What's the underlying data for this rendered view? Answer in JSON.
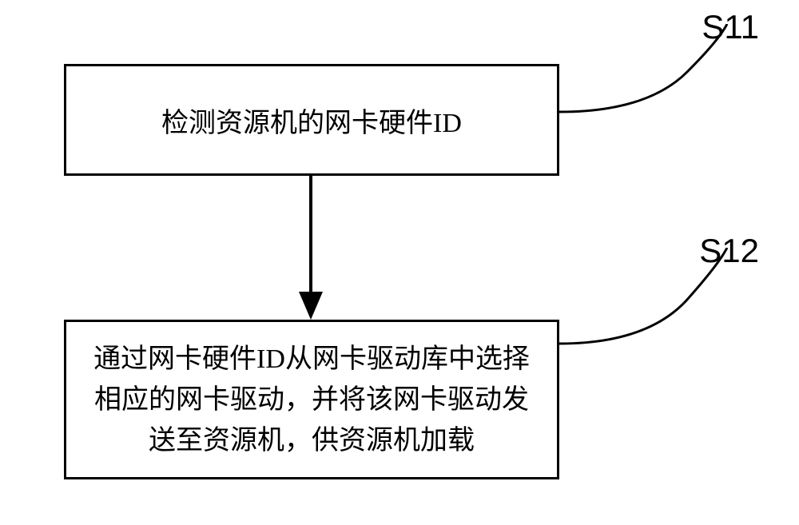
{
  "chart_data": {
    "type": "flowchart",
    "steps": [
      {
        "id": "S11",
        "text": "检测资源机的网卡硬件ID"
      },
      {
        "id": "S12",
        "text": "通过网卡硬件ID从网卡驱动库中选择相应的网卡驱动，并将该网卡驱动发送至资源机，供资源机加载"
      }
    ],
    "connections": [
      {
        "from": "S11",
        "to": "S12",
        "type": "arrow"
      }
    ]
  },
  "box1": {
    "text": "检测资源机的网卡硬件ID",
    "label": "S11"
  },
  "box2": {
    "text": "通过网卡硬件ID从网卡驱动库中选择相应的网卡驱动，并将该网卡驱动发送至资源机，供资源机加载",
    "label": "S12"
  }
}
